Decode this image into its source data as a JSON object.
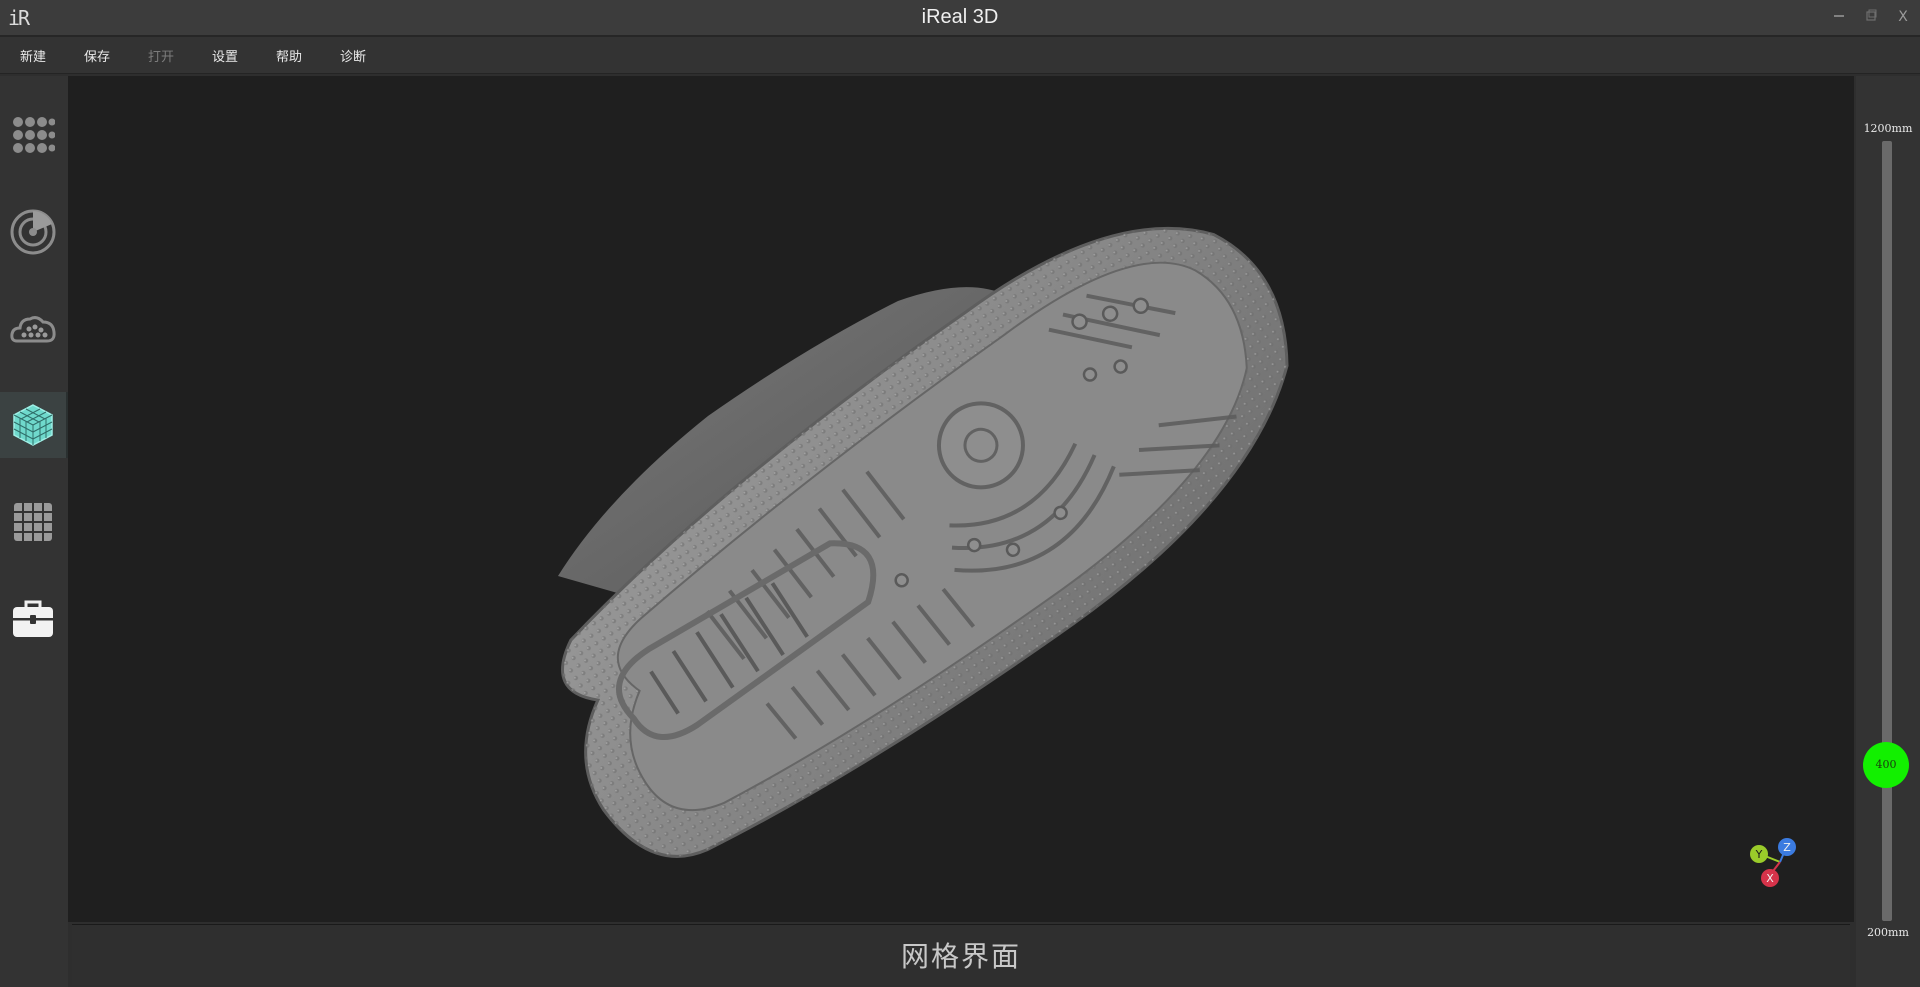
{
  "app": {
    "title": "iReal 3D",
    "logo_text": "iR",
    "window_controls": [
      "minimize-icon",
      "restore-icon",
      "close-icon"
    ],
    "close_label": "X"
  },
  "menu": {
    "items": [
      {
        "label": "新建",
        "enabled": true
      },
      {
        "label": "保存",
        "enabled": true
      },
      {
        "label": "打开",
        "enabled": false
      },
      {
        "label": "设置",
        "enabled": true
      },
      {
        "label": "帮助",
        "enabled": true
      },
      {
        "label": "诊断",
        "enabled": true
      }
    ]
  },
  "toolbar": {
    "tools": [
      {
        "icon": "dots-grid-icon",
        "active": false
      },
      {
        "icon": "radar-scan-icon",
        "active": false
      },
      {
        "icon": "point-cloud-icon",
        "active": false
      },
      {
        "icon": "mesh-cube-icon",
        "active": true
      },
      {
        "icon": "grid-table-icon",
        "active": false
      },
      {
        "icon": "toolbox-icon",
        "active": false
      }
    ]
  },
  "viewport": {
    "model": "shoe-sole-mesh",
    "axis_labels": {
      "y": "Y",
      "z": "Z",
      "x": "X"
    },
    "axis_colors": {
      "x": "#d6334a",
      "y": "#9acb2a",
      "z": "#3b7be0"
    }
  },
  "depth_slider": {
    "max_label": "1200mm",
    "min_label": "200mm",
    "value": 400,
    "value_label": "400",
    "thumb_color": "#12f000"
  },
  "status": {
    "label": "网格界面"
  },
  "colors": {
    "background": "#1f1f1f",
    "panel": "#333333",
    "accent_active": "#3b4242"
  }
}
